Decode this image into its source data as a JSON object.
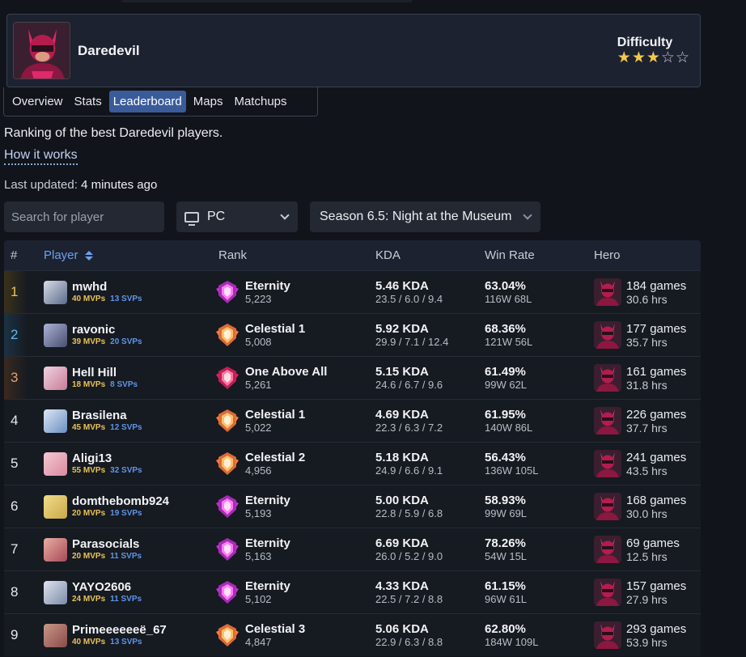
{
  "hero": {
    "name": "Daredevil",
    "difficulty_label": "Difficulty",
    "difficulty_stars": 3,
    "difficulty_max": 5
  },
  "tabs": [
    {
      "label": "Overview",
      "active": false
    },
    {
      "label": "Stats",
      "active": false
    },
    {
      "label": "Leaderboard",
      "active": true
    },
    {
      "label": "Maps",
      "active": false
    },
    {
      "label": "Matchups",
      "active": false
    }
  ],
  "description": "Ranking of the best Daredevil players.",
  "how_it_works": "How it works",
  "last_updated": {
    "label": "Last updated:",
    "value": "4 minutes ago"
  },
  "filters": {
    "search_placeholder": "Search for player",
    "platform": "PC",
    "season": "Season 6.5: Night at the Museum"
  },
  "table": {
    "headers": {
      "pos": "#",
      "player": "Player",
      "rank": "Rank",
      "kda": "KDA",
      "winrate": "Win Rate",
      "hero": "Hero"
    },
    "rows": [
      {
        "pos": "1",
        "name": "mwhd",
        "mvps": "40 MVPs",
        "svps": "13 SVPs",
        "rank": "Eternity",
        "rank_score": "5,223",
        "kda": "5.46 KDA",
        "kda_detail": "23.5 / 6.0 / 9.4",
        "winrate": "63.04%",
        "record": "116W 68L",
        "games": "184 games",
        "hours": "30.6 hrs",
        "rank_tier": "eternity"
      },
      {
        "pos": "2",
        "name": "ravonic",
        "mvps": "39 MVPs",
        "svps": "20 SVPs",
        "rank": "Celestial 1",
        "rank_score": "5,008",
        "kda": "5.92 KDA",
        "kda_detail": "29.9 / 7.1 / 12.4",
        "winrate": "68.36%",
        "record": "121W 56L",
        "games": "177 games",
        "hours": "35.7 hrs",
        "rank_tier": "celestial"
      },
      {
        "pos": "3",
        "name": "Hell Hill",
        "mvps": "18 MVPs",
        "svps": "8 SVPs",
        "rank": "One Above All",
        "rank_score": "5,261",
        "kda": "5.15 KDA",
        "kda_detail": "24.6 / 6.7 / 9.6",
        "winrate": "61.49%",
        "record": "99W 62L",
        "games": "161 games",
        "hours": "31.8 hrs",
        "rank_tier": "oaa"
      },
      {
        "pos": "4",
        "name": "Brasilena",
        "mvps": "45 MVPs",
        "svps": "12 SVPs",
        "rank": "Celestial 1",
        "rank_score": "5,022",
        "kda": "4.69 KDA",
        "kda_detail": "22.3 / 6.3 / 7.2",
        "winrate": "61.95%",
        "record": "140W 86L",
        "games": "226 games",
        "hours": "37.7 hrs",
        "rank_tier": "celestial"
      },
      {
        "pos": "5",
        "name": "Aligi13",
        "mvps": "55 MVPs",
        "svps": "32 SVPs",
        "rank": "Celestial 2",
        "rank_score": "4,956",
        "kda": "5.18 KDA",
        "kda_detail": "24.9 / 6.6 / 9.1",
        "winrate": "56.43%",
        "record": "136W 105L",
        "games": "241 games",
        "hours": "43.5 hrs",
        "rank_tier": "celestial"
      },
      {
        "pos": "6",
        "name": "domthebomb924",
        "mvps": "20 MVPs",
        "svps": "19 SVPs",
        "rank": "Eternity",
        "rank_score": "5,193",
        "kda": "5.00 KDA",
        "kda_detail": "22.8 / 5.9 / 6.8",
        "winrate": "58.93%",
        "record": "99W 69L",
        "games": "168 games",
        "hours": "30.0 hrs",
        "rank_tier": "eternity"
      },
      {
        "pos": "7",
        "name": "Parasocials",
        "mvps": "20 MVPs",
        "svps": "11 SVPs",
        "rank": "Eternity",
        "rank_score": "5,163",
        "kda": "6.69 KDA",
        "kda_detail": "26.0 / 5.2 / 9.0",
        "winrate": "78.26%",
        "record": "54W 15L",
        "games": "69 games",
        "hours": "12.5 hrs",
        "rank_tier": "eternity"
      },
      {
        "pos": "8",
        "name": "YAYO2606",
        "mvps": "24 MVPs",
        "svps": "11 SVPs",
        "rank": "Eternity",
        "rank_score": "5,102",
        "kda": "4.33 KDA",
        "kda_detail": "22.5 / 7.2 / 8.8",
        "winrate": "61.15%",
        "record": "96W 61L",
        "games": "157 games",
        "hours": "27.9 hrs",
        "rank_tier": "eternity"
      },
      {
        "pos": "9",
        "name": "Primeeeeeeë_67",
        "mvps": "40 MVPs",
        "svps": "13 SVPs",
        "rank": "Celestial 3",
        "rank_score": "4,847",
        "kda": "5.06 KDA",
        "kda_detail": "22.9 / 6.3 / 8.8",
        "winrate": "62.80%",
        "record": "184W 109L",
        "games": "293 games",
        "hours": "53.9 hrs",
        "rank_tier": "celestial"
      }
    ]
  },
  "colors": {
    "accent": "#3a5b9a",
    "mvp": "#e8c25a",
    "svp": "#5f95e8",
    "gold": "#e8c25a",
    "silver_blue": "#5fb9ec",
    "bronze": "#e0a070"
  }
}
